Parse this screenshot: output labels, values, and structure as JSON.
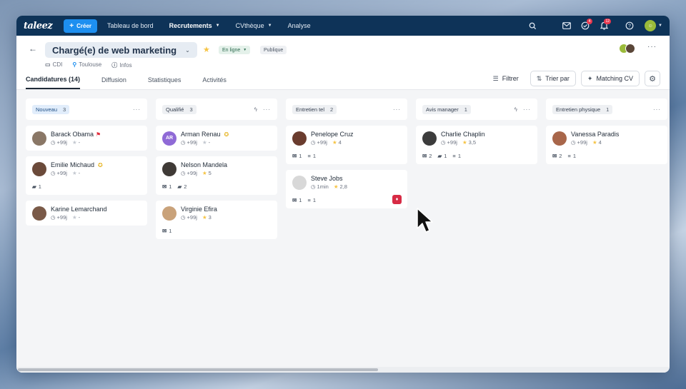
{
  "nav": {
    "logo": "taleez",
    "create_label": "Créer",
    "items": [
      {
        "label": "Tableau de bord",
        "active": false,
        "caret": ""
      },
      {
        "label": "Recrutements",
        "active": true,
        "caret": "▼"
      },
      {
        "label": "CVthèque",
        "active": false,
        "caret": "▼"
      },
      {
        "label": "Analyse",
        "active": false,
        "caret": ""
      }
    ],
    "tasks_badge": "4",
    "notifications_badge": "12"
  },
  "job": {
    "title": "Chargé(e) de web marketing",
    "status": "En ligne",
    "visibility": "Publique",
    "contract": "CDI",
    "location": "Toulouse",
    "infos": "Infos"
  },
  "tabs": [
    "Candidatures (14)",
    "Diffusion",
    "Statistiques",
    "Activités"
  ],
  "actions": {
    "filter": "Filtrer",
    "sort": "Trier par",
    "matching": "Matching CV"
  },
  "columns": [
    {
      "name": "Nouveau",
      "count": "3",
      "cards": [
        {
          "name": "Barack Obama",
          "time": "+99j",
          "rating": "-",
          "flag": true
        },
        {
          "name": "Emilie Michaud",
          "time": "+99j",
          "rating": "-",
          "medal": true,
          "messages": "1"
        },
        {
          "name": "Karine Lemarchand",
          "time": "+99j",
          "rating": "-"
        }
      ]
    },
    {
      "name": "Qualifié",
      "count": "3",
      "cards": [
        {
          "name": "Arman Renau",
          "time": "+99j",
          "rating": "-",
          "medal": true,
          "initials": "AR"
        },
        {
          "name": "Nelson Mandela",
          "time": "+99j",
          "rating": "5",
          "mails": "1",
          "messages": "2"
        },
        {
          "name": "Virginie Efira",
          "time": "+99j",
          "rating": "3",
          "mails": "1"
        }
      ]
    },
    {
      "name": "Entretien tel",
      "count": "2",
      "cards": [
        {
          "name": "Penelope Cruz",
          "time": "+99j",
          "rating": "4",
          "mails": "1",
          "notes": "1"
        },
        {
          "name": "Steve Jobs",
          "time": "1min",
          "rating": "2,8",
          "mails": "1",
          "notes": "1"
        }
      ]
    },
    {
      "name": "Avis manager",
      "count": "1",
      "cards": [
        {
          "name": "Charlie Chaplin",
          "time": "+99j",
          "rating": "3,5",
          "mails": "2",
          "messages": "1",
          "notes": "1"
        }
      ]
    },
    {
      "name": "Entretien physique",
      "count": "1",
      "cards": [
        {
          "name": "Vanessa Paradis",
          "time": "+99j",
          "rating": "4",
          "mails": "2",
          "notes": "1"
        }
      ]
    }
  ],
  "colors": {
    "nav_bg": "#0e3358",
    "accent": "#1d8ff0",
    "alert": "#d72b45",
    "star": "#f6c445"
  }
}
